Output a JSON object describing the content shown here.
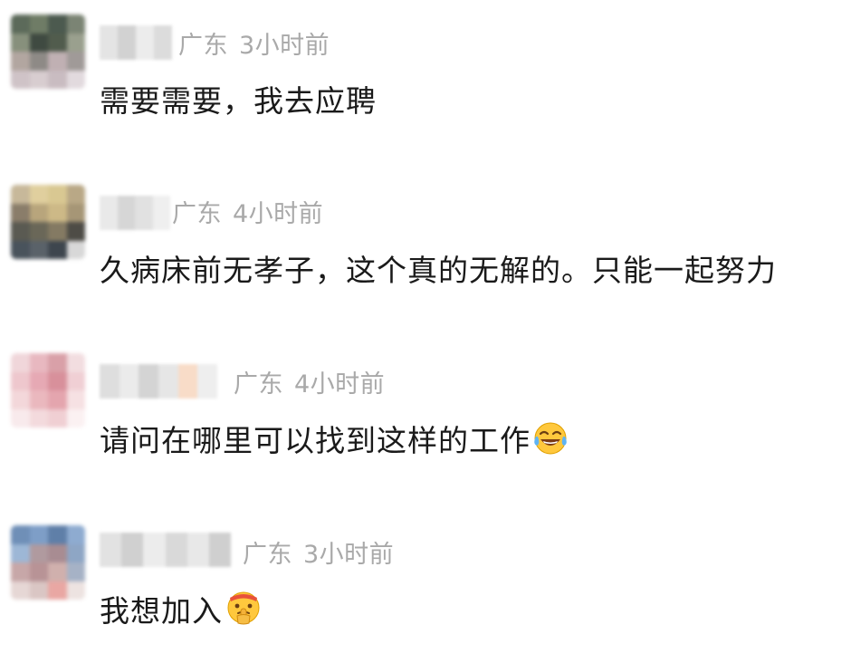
{
  "comments": [
    {
      "location": "广东",
      "time": "3小时前",
      "text": "需要需要，我去应聘",
      "emoji": "",
      "avatar_colors": [
        "#5c6a5a",
        "#6f7c66",
        "#4c5a4f",
        "#7b8474",
        "#87907c",
        "#3f4a41",
        "#515c4d",
        "#9aa08e",
        "#b2a6a0",
        "#8e8a86",
        "#c0b0b3",
        "#a09a98",
        "#cfc3c7",
        "#d8cdd0",
        "#c9bcc1",
        "#e2dade"
      ]
    },
    {
      "location": "广东",
      "time": "4小时前",
      "text": "久病床前无孝子，这个真的无解的。只能一起努力",
      "emoji": "",
      "avatar_colors": [
        "#c7b89a",
        "#e0cf9e",
        "#d9c892",
        "#b9a886",
        "#8a7d6a",
        "#b8a57c",
        "#cdb987",
        "#a69676",
        "#5a5a52",
        "#6a6758",
        "#847a63",
        "#4e4c46",
        "#49535c",
        "#5a6269",
        "#3e464e",
        "#d8d8d8"
      ]
    },
    {
      "location": "广东",
      "time": "4小时前",
      "text": "请问在哪里可以找到这样的工作",
      "emoji": "laughing-tears-emoji",
      "avatar_colors": [
        "#f0d6da",
        "#e8b8c0",
        "#d9a0a8",
        "#f2dde0",
        "#eec7cd",
        "#e6a9b4",
        "#d8909b",
        "#f0cfd4",
        "#f3d7da",
        "#eab8be",
        "#e4a5ae",
        "#f6e1e3",
        "#f8eaec",
        "#f3dadd",
        "#f0cfd3",
        "#fbf1f2"
      ]
    },
    {
      "location": "广东",
      "time": "3小时前",
      "text": "我想加入",
      "emoji": "shushing-face-emoji",
      "avatar_colors": [
        "#6f8fb7",
        "#7e9ec7",
        "#5f7fa8",
        "#8eabd0",
        "#9db7d6",
        "#b09a9f",
        "#a88c92",
        "#8ea6c5",
        "#c7a7a8",
        "#b89396",
        "#d0b0ad",
        "#a6b2c6",
        "#e6d7d5",
        "#dac6c4",
        "#e9a7a3",
        "#ede3e1"
      ]
    }
  ],
  "colors": {
    "text": "#1a1a1a",
    "meta": "#a9a9a9",
    "background": "#ffffff"
  }
}
